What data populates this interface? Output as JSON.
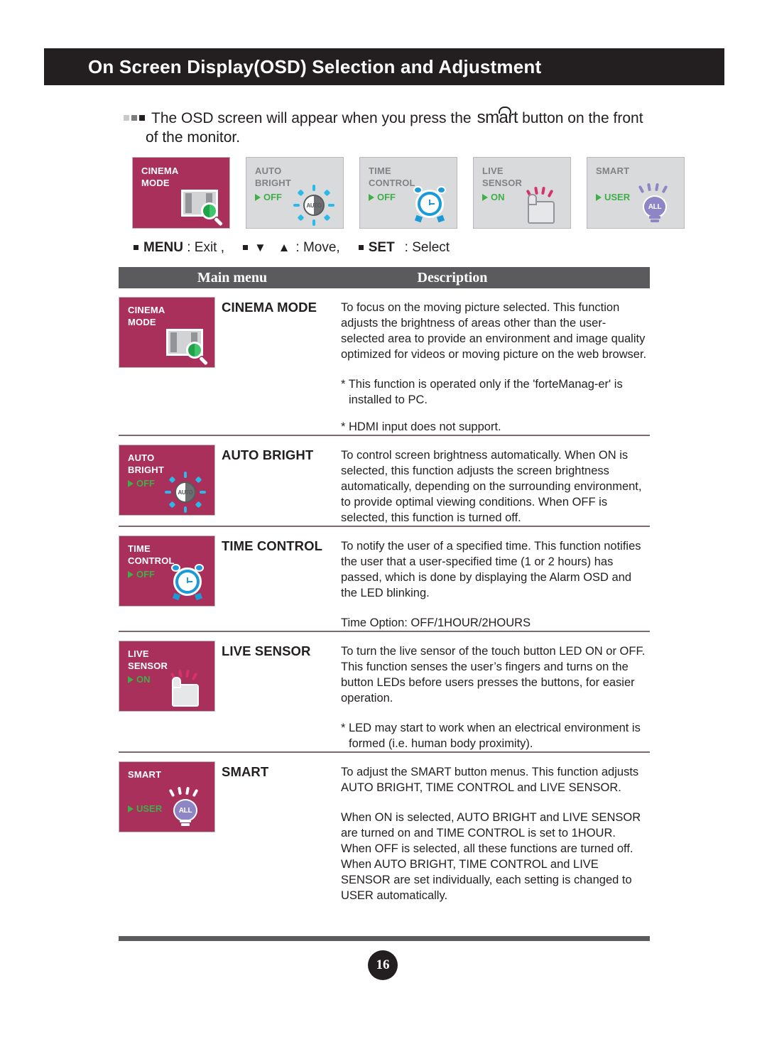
{
  "header": {
    "title": "On Screen Display(OSD) Selection and Adjustment"
  },
  "intro": {
    "bullet_icon": "three-squares-bullet",
    "line1_before": "The OSD screen will appear when you press the",
    "logo": "smart",
    "line1_after": "button on the front",
    "line2": "of the monitor."
  },
  "osd_thumbnails": [
    {
      "id": "cinema-mode",
      "label_line1": "CINEMA",
      "label_line2": "MODE",
      "value": "",
      "selected": true,
      "icon": "monitor-magnifier-icon"
    },
    {
      "id": "auto-bright",
      "label_line1": "AUTO",
      "label_line2": "BRIGHT",
      "value": "OFF",
      "selected": false,
      "icon": "auto-brightness-dial-icon"
    },
    {
      "id": "time-control",
      "label_line1": "TIME",
      "label_line2": "CONTROL",
      "value": "OFF",
      "selected": false,
      "icon": "alarm-clock-icon"
    },
    {
      "id": "live-sensor",
      "label_line1": "LIVE",
      "label_line2": "SENSOR",
      "value": "ON",
      "selected": false,
      "icon": "touch-finger-icon"
    },
    {
      "id": "smart",
      "label_line1": "SMART",
      "label_line2": "",
      "value": "USER",
      "selected": false,
      "icon": "light-bulb-all-icon"
    }
  ],
  "key_legend": {
    "menu_key": "MENU",
    "menu_action": ": Exit ,",
    "move_arrows": "▼ ▲",
    "move_action": ": Move,",
    "set_key": "SET",
    "set_action": ": Select"
  },
  "table": {
    "headers": {
      "main_menu": "Main menu",
      "description": "Description"
    },
    "rows": [
      {
        "osd": {
          "id": "cinema-mode",
          "label_line1": "CINEMA",
          "label_line2": "MODE",
          "value": "",
          "icon": "monitor-magnifier-icon"
        },
        "menu_name": "CINEMA MODE",
        "paragraphs": [
          "To focus on the moving picture selected.\nThis function adjusts the brightness of areas other than the user-selected area to provide an environment and image quality optimized for videos or moving picture on the web browser."
        ],
        "notes": [
          "* This function is operated only if the 'forteManag-er' is installed to PC.",
          "* HDMI input does not support."
        ]
      },
      {
        "osd": {
          "id": "auto-bright",
          "label_line1": "AUTO",
          "label_line2": "BRIGHT",
          "value": "OFF",
          "icon": "auto-brightness-dial-icon"
        },
        "menu_name": "AUTO BRIGHT",
        "paragraphs": [
          "To control screen brightness automatically.\nWhen ON is selected, this function adjusts the screen brightness automatically, depending on the surrounding environment, to provide optimal viewing conditions.\nWhen OFF is selected, this function is turned off."
        ],
        "notes": []
      },
      {
        "osd": {
          "id": "time-control",
          "label_line1": "TIME",
          "label_line2": "CONTROL",
          "value": "OFF",
          "icon": "alarm-clock-icon"
        },
        "menu_name": "TIME CONTROL",
        "paragraphs": [
          "To notify the user of a specified time.\nThis function notifies the user that a user-specified time (1 or 2 hours) has passed, which is done by displaying the Alarm OSD and the LED blinking."
        ],
        "notes": [
          "Time Option: OFF/1HOUR/2HOURS"
        ]
      },
      {
        "osd": {
          "id": "live-sensor",
          "label_line1": "LIVE",
          "label_line2": "SENSOR",
          "value": "ON",
          "icon": "touch-finger-icon"
        },
        "menu_name": "LIVE SENSOR",
        "paragraphs": [
          "To turn the live sensor of the touch button LED ON or OFF. This function senses the user’s fingers and turns on the button LEDs before users presses the buttons, for easier operation."
        ],
        "notes": [
          "* LED may start to work when an electrical environment is formed (i.e. human body proximity)."
        ]
      },
      {
        "osd": {
          "id": "smart",
          "label_line1": "SMART",
          "label_line2": "",
          "value": "USER",
          "icon": "light-bulb-all-icon"
        },
        "menu_name": "SMART",
        "paragraphs": [
          "To adjust the SMART button menus.\nThis function adjusts AUTO BRIGHT, TIME CONTROL and LIVE SENSOR."
        ],
        "notes": [
          "When ON is selected, AUTO BRIGHT and LIVE SENSOR are turned on and TIME CONTROL is set to 1HOUR. When OFF is selected, all these functions are turned off. When AUTO BRIGHT, TIME CONTROL and LIVE SENSOR are set individually, each setting is changed to USER automatically."
        ]
      }
    ]
  },
  "footer": {
    "page_number": "16"
  },
  "colors": {
    "header_bar": "#231f20",
    "osd_selected": "#a8305a",
    "osd_unselected": "#d9dadb",
    "value_green": "#3fae49",
    "table_header": "#5b5b5d",
    "row_divider": "#7c6a70"
  }
}
